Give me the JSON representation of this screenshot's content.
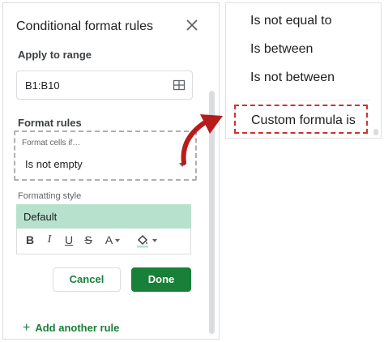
{
  "panel": {
    "title": "Conditional format rules",
    "apply_label": "Apply to range",
    "range_value": "B1:B10",
    "rules_label": "Format rules",
    "condition_caption": "Format cells if…",
    "condition_value": "Is not empty",
    "style_label": "Formatting style",
    "style_default": "Default",
    "style_preview_color": "#b7e1cd",
    "toolbar": {
      "bold": "B",
      "italic": "I",
      "underline": "U",
      "strike": "S",
      "text_color": "A"
    },
    "cancel_label": "Cancel",
    "done_label": "Done",
    "add_rule_label": "Add another rule",
    "add_rule_icon": "+",
    "accent_color": "#188038"
  },
  "menu": {
    "items": [
      "Is not equal to",
      "Is between",
      "Is not between"
    ],
    "highlighted_item": "Custom formula is",
    "highlight_color": "#d32f2f"
  }
}
